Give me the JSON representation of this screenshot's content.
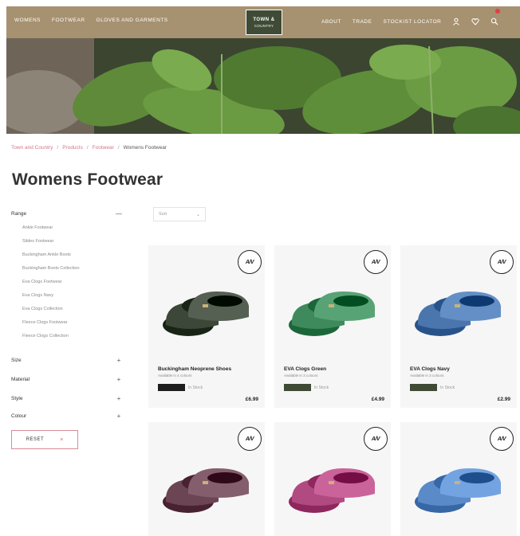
{
  "header": {
    "nav_left": [
      "Womens",
      "Footwear",
      "Gloves and Garments"
    ],
    "nav_right": [
      "About",
      "Trade",
      "Stockist locator"
    ],
    "logo_line1": "TOWN &",
    "logo_line2": "COUNTRY",
    "icons": [
      "user-icon",
      "heart-icon",
      "search-icon"
    ]
  },
  "breadcrumb": {
    "items": [
      "Town and Country",
      "Products",
      "Footwear"
    ],
    "current": "Womens Footwear"
  },
  "page_title": "Womens Footwear",
  "filters": {
    "range_label": "Range",
    "range_toggle": "—",
    "categories": [
      "Ankle Footwear",
      "Slides Footwear",
      "Buckingham Ankle Boots",
      "Buckingham Boots Collection",
      "Eva Clogs Footwear",
      "Eva Clogs Navy",
      "Eva Clogs Collection",
      "Fleece Clogs Footwear",
      "Fleece Clogs Collection"
    ],
    "groups": [
      {
        "label": "Size",
        "toggle": "+"
      },
      {
        "label": "Material",
        "toggle": "+"
      },
      {
        "label": "Style",
        "toggle": "+"
      },
      {
        "label": "Colour",
        "toggle": "+"
      }
    ],
    "reset_label": "RESET",
    "reset_icon": "×"
  },
  "sort": {
    "label": "Sort",
    "chevron": "⌄"
  },
  "products": [
    {
      "name": "Buckingham Neoprene Shoes",
      "sub": "Available in 4 colours",
      "stock": "In Stock",
      "price": "£6.99",
      "swatch": "#1e1e1e",
      "shoe_color": "#3c4639",
      "badge": "A/V"
    },
    {
      "name": "EVA Clogs Green",
      "sub": "Available in 3 colours",
      "stock": "In Stock",
      "price": "£4.99",
      "swatch": "#3f4b35",
      "shoe_color": "#3f8a5c",
      "badge": "A/V"
    },
    {
      "name": "EVA Clogs Navy",
      "sub": "Available in 3 colours",
      "stock": "In Stock",
      "price": "£2.99",
      "swatch": "#3f4b35",
      "shoe_color": "#4b76ad",
      "badge": "A/V"
    },
    {
      "name": "",
      "sub": "",
      "stock": "",
      "price": "",
      "swatch": "",
      "shoe_color": "#6b4553",
      "badge": "A/V"
    },
    {
      "name": "",
      "sub": "",
      "stock": "",
      "price": "",
      "swatch": "",
      "shoe_color": "#b24a82",
      "badge": "A/V"
    },
    {
      "name": "",
      "sub": "",
      "stock": "",
      "price": "",
      "swatch": "",
      "shoe_color": "#5a8ac8",
      "badge": "A/V"
    }
  ],
  "colors": {
    "header_bar": "#b09876",
    "accent_pink": "#d4758a",
    "brand_green": "#3f4b35"
  }
}
